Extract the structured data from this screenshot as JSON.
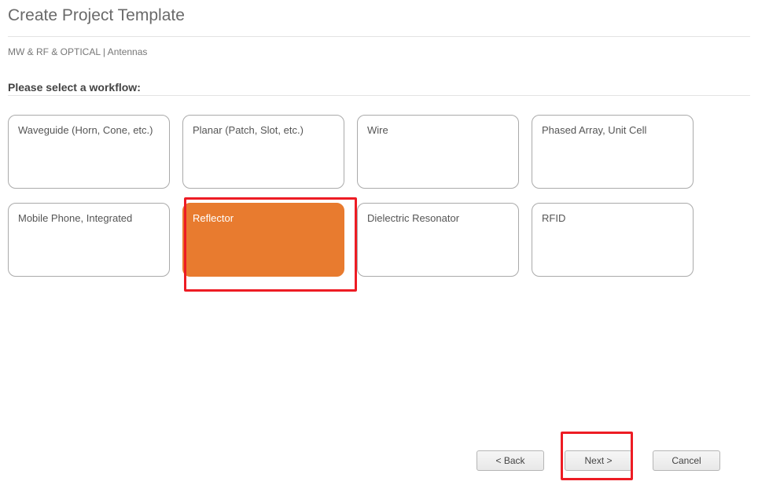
{
  "title": "Create Project Template",
  "breadcrumb": "MW & RF & OPTICAL | Antennas",
  "section_heading": "Please select a workflow:",
  "workflows": [
    {
      "label": "Waveguide (Horn, Cone, etc.)",
      "selected": false
    },
    {
      "label": "Planar (Patch, Slot, etc.)",
      "selected": false
    },
    {
      "label": "Wire",
      "selected": false
    },
    {
      "label": "Phased Array, Unit Cell",
      "selected": false
    },
    {
      "label": "Mobile Phone, Integrated",
      "selected": false
    },
    {
      "label": "Reflector",
      "selected": true
    },
    {
      "label": "Dielectric Resonator",
      "selected": false
    },
    {
      "label": "RFID",
      "selected": false
    }
  ],
  "footer": {
    "back": "< Back",
    "next": "Next >",
    "cancel": "Cancel"
  }
}
